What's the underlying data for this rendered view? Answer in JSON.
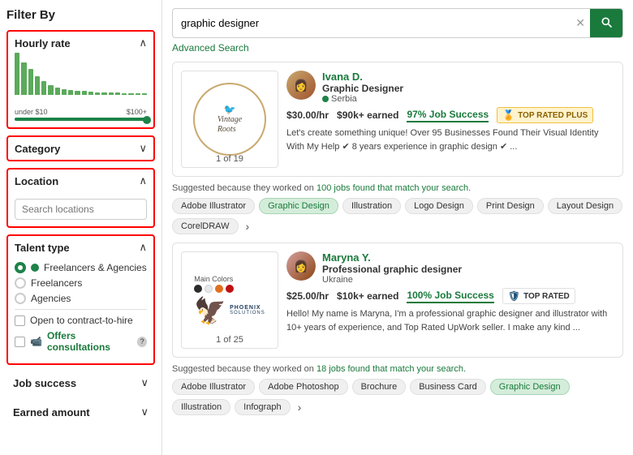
{
  "sidebar": {
    "title": "Filter By",
    "hourlyRate": {
      "label": "Hourly rate",
      "minLabel": "under $10",
      "maxLabel": "$100+",
      "bars": [
        90,
        70,
        55,
        40,
        30,
        20,
        15,
        12,
        10,
        8,
        8,
        7,
        6,
        5,
        5,
        5,
        4,
        4,
        4,
        3
      ]
    },
    "category": {
      "label": "Category"
    },
    "location": {
      "label": "Location",
      "searchPlaceholder": "Search locations"
    },
    "talentType": {
      "label": "Talent type",
      "options": [
        {
          "label": "Freelancers & Agencies",
          "selected": true,
          "type": "radio"
        },
        {
          "label": "Freelancers",
          "selected": false,
          "type": "radio"
        },
        {
          "label": "Agencies",
          "selected": false,
          "type": "radio"
        }
      ],
      "checkboxOptions": [
        {
          "label": "Open to contract-to-hire",
          "checked": false
        },
        {
          "label": "Offers consultations",
          "checked": false,
          "green": true
        }
      ]
    },
    "jobSuccess": {
      "label": "Job success"
    },
    "earnedAmount": {
      "label": "Earned amount"
    }
  },
  "search": {
    "value": "graphic designer",
    "placeholder": "graphic designer",
    "advancedLink": "Advanced Search",
    "icon": "🔍"
  },
  "profiles": [
    {
      "id": 1,
      "name": "Ivana D.",
      "title": "Graphic Designer",
      "location": "Serbia",
      "online": true,
      "rate": "$30.00/hr",
      "earned": "$90k+ earned",
      "jobSuccess": "97% Job Success",
      "badge": "TOP RATED PLUS",
      "badgeType": "plus",
      "description": "Let's create something unique! Over 95 Businesses Found Their Visual Identity With My Help ✔ 8 years experience in graphic design ✔ ...",
      "imageCount": "1 of 19",
      "suggestedText": "Suggested because they worked on",
      "suggestedCount": "100 jobs found that match your search.",
      "tags": [
        "Adobe Illustrator",
        "Graphic Design",
        "Illustration",
        "Logo Design",
        "Print Design",
        "Layout Design",
        "CorelDRAW"
      ]
    },
    {
      "id": 2,
      "name": "Maryna Y.",
      "title": "Professional graphic designer",
      "location": "Ukraine",
      "online": false,
      "rate": "$25.00/hr",
      "earned": "$10k+ earned",
      "jobSuccess": "100% Job Success",
      "badge": "TOP RATED",
      "badgeType": "standard",
      "description": "Hello! My name is Maryna, I'm a professional graphic designer and illustrator with 10+ years of experience, and Top Rated UpWork seller. I make any kind ...",
      "imageCount": "1 of 25",
      "suggestedText": "Suggested because they worked on",
      "suggestedCount": "18 jobs found that match your search.",
      "tags": [
        "Adobe Illustrator",
        "Adobe Photoshop",
        "Brochure",
        "Business Card",
        "Graphic Design",
        "Illustration",
        "Infograph"
      ]
    }
  ],
  "icons": {
    "chevronUp": "∧",
    "chevronDown": "∨",
    "close": "✕",
    "search": "🔍",
    "shield": "🛡",
    "heartUpwork": "💚",
    "question": "?",
    "videoCamera": "📹",
    "chevronRight": "›"
  }
}
